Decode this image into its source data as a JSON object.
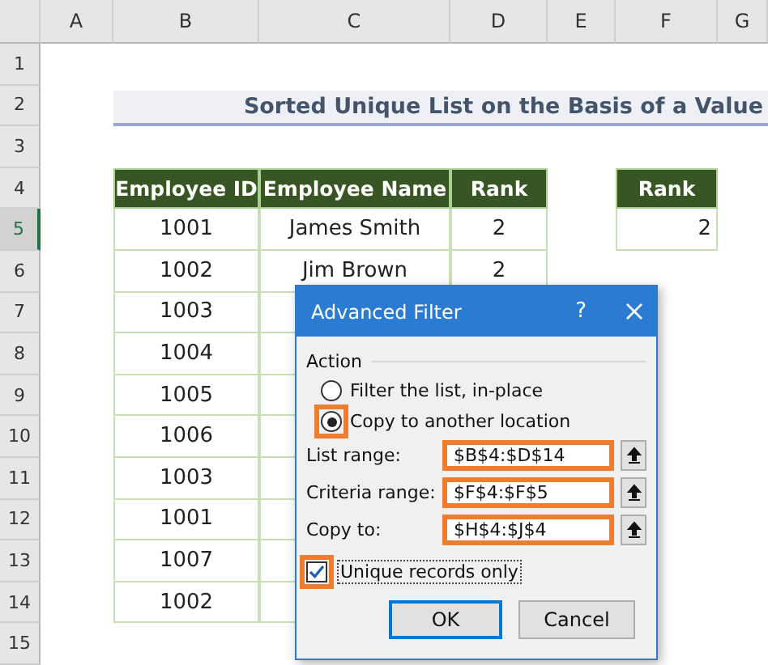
{
  "columns": [
    "A",
    "B",
    "C",
    "D",
    "E",
    "F",
    "G"
  ],
  "rows": [
    {
      "label": "1",
      "selected": false
    },
    {
      "label": "2",
      "selected": false
    },
    {
      "label": "3",
      "selected": false
    },
    {
      "label": "4",
      "selected": false
    },
    {
      "label": "5",
      "selected": true
    },
    {
      "label": "6",
      "selected": false
    },
    {
      "label": "7",
      "selected": false
    },
    {
      "label": "8",
      "selected": false
    },
    {
      "label": "9",
      "selected": false
    },
    {
      "label": "10",
      "selected": false
    },
    {
      "label": "11",
      "selected": false
    },
    {
      "label": "12",
      "selected": false
    },
    {
      "label": "13",
      "selected": false
    },
    {
      "label": "14",
      "selected": false
    },
    {
      "label": "15",
      "selected": false
    }
  ],
  "title": "Sorted Unique List on the Basis of a Value",
  "table": {
    "columns": [
      "Employee ID",
      "Employee Name",
      "Rank"
    ],
    "rows": [
      {
        "id": "1001",
        "name": "James Smith",
        "rank": "2"
      },
      {
        "id": "1002",
        "name": "Jim Brown",
        "rank": "2"
      },
      {
        "id": "1003"
      },
      {
        "id": "1004"
      },
      {
        "id": "1005"
      },
      {
        "id": "1006"
      },
      {
        "id": "1003"
      },
      {
        "id": "1001"
      },
      {
        "id": "1007"
      },
      {
        "id": "1002"
      }
    ]
  },
  "criteria": {
    "header": "Rank",
    "value": "2"
  },
  "dialog": {
    "title": "Advanced Filter",
    "help": "?",
    "group": "Action",
    "options": [
      {
        "label": "Filter the list, in-place",
        "selected": false,
        "highlighted": false
      },
      {
        "label": "Copy to another location",
        "selected": true,
        "highlighted": true
      }
    ],
    "fields": [
      {
        "label": "List range:",
        "value": "$B$4:$D$14",
        "highlighted": true
      },
      {
        "label": "Criteria range:",
        "value": "$F$4:$F$5",
        "highlighted": true
      },
      {
        "label": "Copy to:",
        "value": "$H$4:$J$4",
        "highlighted": true
      }
    ],
    "checkbox": {
      "label": "Unique records only",
      "checked": true,
      "highlighted": true
    },
    "buttons": [
      {
        "label": "OK",
        "kind": "default"
      },
      {
        "label": "Cancel",
        "kind": "normal"
      }
    ]
  }
}
